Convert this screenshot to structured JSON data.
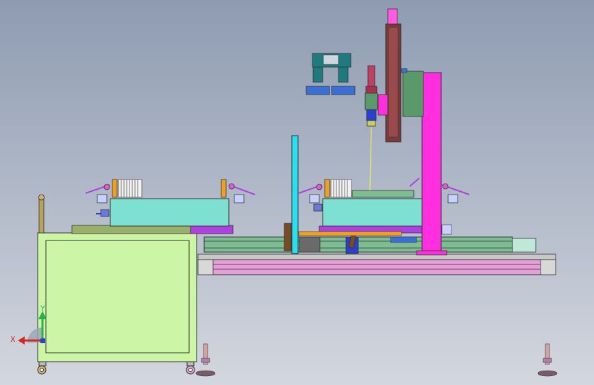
{
  "view": {
    "background_top": "#8e9bb1",
    "background_bottom": "#d3d7df"
  },
  "triad": {
    "x_label": "X",
    "y_label": "Y",
    "x_color": "#d8261e",
    "y_color": "#27b34a",
    "z_color": "#2a3fcf"
  },
  "palette": {
    "cabinet": "#ccf5a6",
    "base_frame": "#e3a1d6",
    "rail_green": "#7dbd8f",
    "cyan_tank": "#7de0d0",
    "magenta_column": "#ff2fe0",
    "cyan_post": "#2ae0f0",
    "gantry_rail": "#7a3a3a",
    "laser_body": "#c04060",
    "camera_teal": "#1f7a80",
    "camera_blue": "#3a6fd8",
    "purple": "#b040e0",
    "orange": "#f0a020",
    "olive": "#9ab06a"
  }
}
